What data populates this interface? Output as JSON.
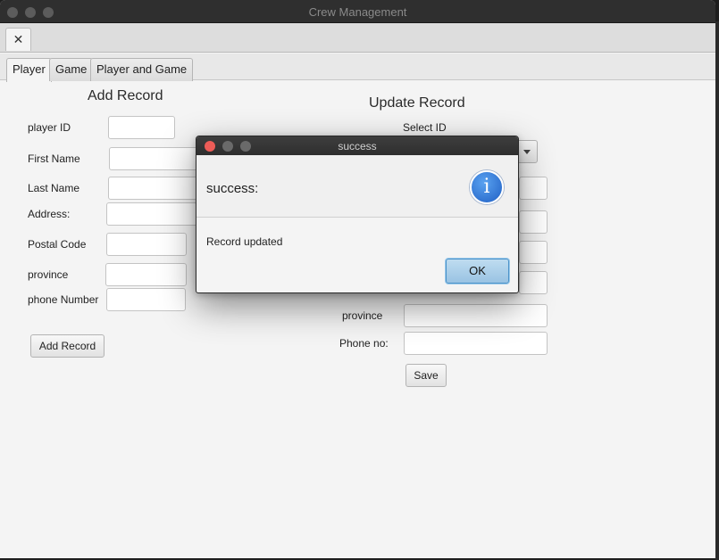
{
  "window": {
    "title": "Crew Management"
  },
  "toolbar": {
    "close_tab": "✕"
  },
  "tabs": [
    {
      "label": "Player",
      "active": true
    },
    {
      "label": "Game",
      "active": false
    },
    {
      "label": "Player and Game",
      "active": false
    }
  ],
  "add_record": {
    "heading": "Add Record",
    "fields": [
      {
        "label": "player ID",
        "value": ""
      },
      {
        "label": "First Name",
        "value": ""
      },
      {
        "label": "Last Name",
        "value": ""
      },
      {
        "label": "Address:",
        "value": ""
      },
      {
        "label": "Postal Code",
        "value": ""
      },
      {
        "label": "province",
        "value": ""
      },
      {
        "label": "phone Number",
        "value": ""
      }
    ],
    "button": "Add Record"
  },
  "update_record": {
    "heading": "Update Record",
    "select_label": "Select ID",
    "fields": [
      {
        "label": "province",
        "value": ""
      },
      {
        "label": "Phone no:",
        "value": ""
      }
    ],
    "button": "Save"
  },
  "dialog": {
    "title": "success",
    "header": "success:",
    "icon": "info-icon",
    "content": "Record updated",
    "ok": "OK"
  },
  "colors": {
    "accent": "#99c3e3",
    "info_icon": "#2f74d0",
    "close_dot": "#ed5c57"
  }
}
